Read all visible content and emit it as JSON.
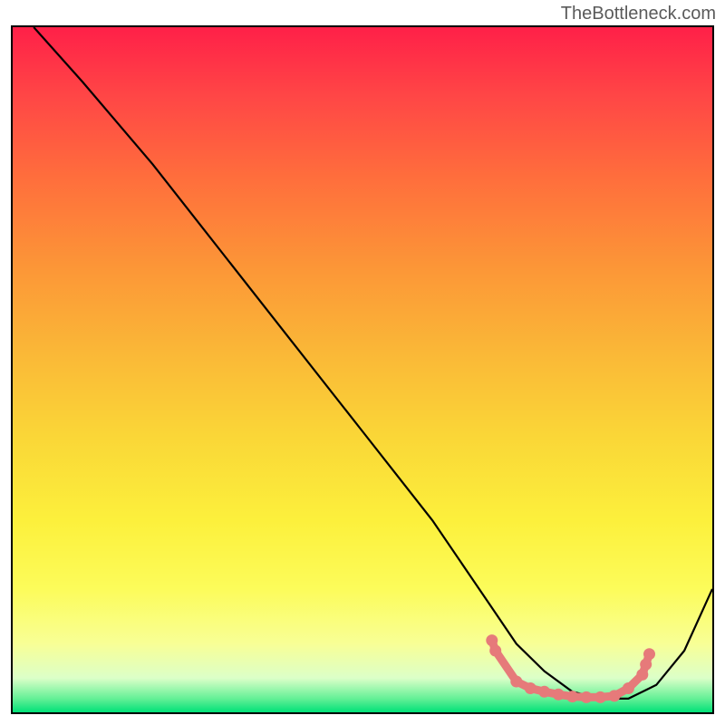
{
  "watermark": "TheBottleneck.com",
  "chart_data": {
    "type": "line",
    "title": "",
    "xlabel": "",
    "ylabel": "",
    "xlim": [
      0,
      100
    ],
    "ylim": [
      0,
      100
    ],
    "series": [
      {
        "name": "curve",
        "x": [
          3,
          10,
          20,
          30,
          40,
          50,
          60,
          68,
          72,
          76,
          80,
          84,
          88,
          92,
          96,
          100
        ],
        "y": [
          100,
          92,
          80,
          67,
          54,
          41,
          28,
          16,
          10,
          6,
          3,
          2,
          2,
          4,
          9,
          18
        ]
      }
    ],
    "highlight_points": [
      {
        "x": 68.5,
        "y": 10.5
      },
      {
        "x": 69,
        "y": 9
      },
      {
        "x": 72,
        "y": 4.5
      },
      {
        "x": 74,
        "y": 3.5
      },
      {
        "x": 76,
        "y": 3
      },
      {
        "x": 78,
        "y": 2.6
      },
      {
        "x": 80,
        "y": 2.3
      },
      {
        "x": 82,
        "y": 2.2
      },
      {
        "x": 84,
        "y": 2.2
      },
      {
        "x": 86,
        "y": 2.4
      },
      {
        "x": 88,
        "y": 3.5
      },
      {
        "x": 90,
        "y": 5.5
      },
      {
        "x": 90.5,
        "y": 7
      },
      {
        "x": 91,
        "y": 8.5
      }
    ]
  }
}
